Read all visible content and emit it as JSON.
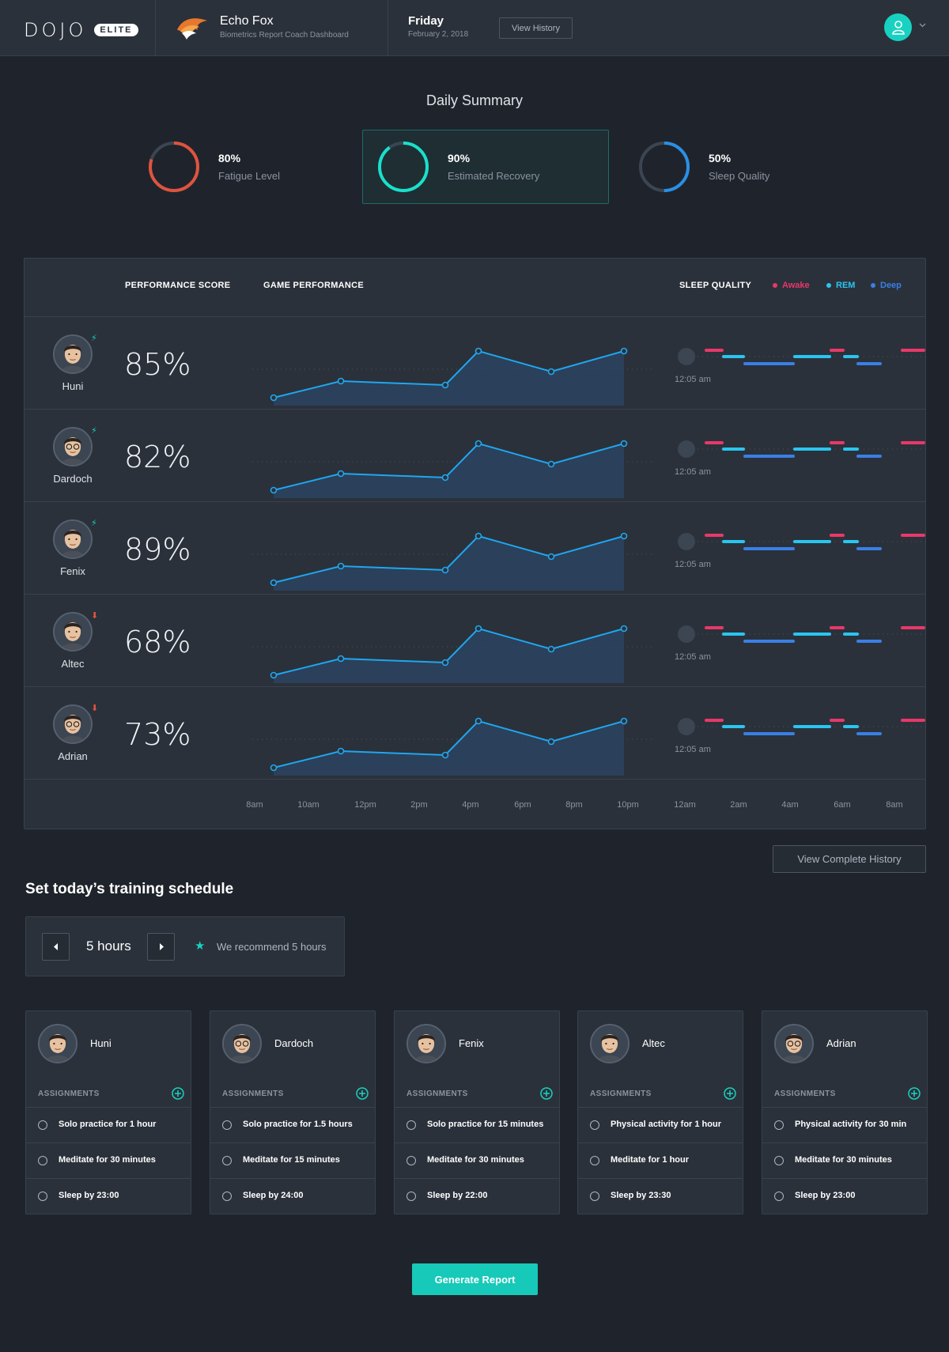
{
  "brand": {
    "logo": "DOJO",
    "badge": "ELITE"
  },
  "team": {
    "name": "Echo Fox",
    "subtitle": "Biometrics Report Coach Dashboard"
  },
  "date": {
    "day": "Friday",
    "full": "February 2, 2018"
  },
  "header": {
    "view_history": "View History"
  },
  "summary": {
    "title": "Daily Summary",
    "metrics": [
      {
        "value": "80%",
        "label": "Fatigue Level",
        "fraction": 0.8,
        "color": "#e0533f"
      },
      {
        "value": "90%",
        "label": "Estimated Recovery",
        "fraction": 0.9,
        "color": "#18e0cc"
      },
      {
        "value": "50%",
        "label": "Sleep Quality",
        "fraction": 0.5,
        "color": "#2a8fe6"
      }
    ]
  },
  "performance": {
    "headers": {
      "score": "PERFORMANCE SCORE",
      "game": "GAME PERFORMANCE",
      "sleep": "SLEEP QUALITY"
    },
    "legend": [
      {
        "label": "Awake",
        "color": "#e8386a"
      },
      {
        "label": "REM",
        "color": "#29c5f0"
      },
      {
        "label": "Deep",
        "color": "#3a7fe6"
      }
    ],
    "rows": [
      {
        "name": "Huni",
        "score": "85%",
        "trend": "up",
        "sleep_time": "12:05 am"
      },
      {
        "name": "Dardoch",
        "score": "82%",
        "trend": "up",
        "sleep_time": "12:05 am"
      },
      {
        "name": "Fenix",
        "score": "89%",
        "trend": "up",
        "sleep_time": "12:05 am"
      },
      {
        "name": "Altec",
        "score": "68%",
        "trend": "down",
        "sleep_time": "12:05 am"
      },
      {
        "name": "Adrian",
        "score": "73%",
        "trend": "down",
        "sleep_time": "12:05 am"
      }
    ],
    "x_ticks": [
      "8am",
      "10am",
      "12pm",
      "2pm",
      "4pm",
      "6pm",
      "8pm",
      "10pm",
      "12am",
      "2am",
      "4am",
      "6am",
      "8am"
    ],
    "view_complete": "View Complete History"
  },
  "schedule": {
    "title": "Set today’s training schedule",
    "hours": "5 hours",
    "recommend": "We recommend 5 hours",
    "assign_label": "ASSIGNMENTS",
    "players": [
      {
        "name": "Huni",
        "tasks": [
          "Solo practice for 1 hour",
          "Meditate for 30 minutes",
          "Sleep by 23:00"
        ]
      },
      {
        "name": "Dardoch",
        "tasks": [
          "Solo practice for 1.5 hours",
          "Meditate for 15 minutes",
          "Sleep by 24:00"
        ]
      },
      {
        "name": "Fenix",
        "tasks": [
          "Solo practice for 15 minutes",
          "Meditate for 30 minutes",
          "Sleep by 22:00"
        ]
      },
      {
        "name": "Altec",
        "tasks": [
          "Physical activity for 1 hour",
          "Meditate for 1 hour",
          "Sleep by 23:30"
        ]
      },
      {
        "name": "Adrian",
        "tasks": [
          "Physical activity for 30 min",
          "Meditate for 30 minutes",
          "Sleep by 23:00"
        ]
      }
    ],
    "generate": "Generate Report"
  }
}
